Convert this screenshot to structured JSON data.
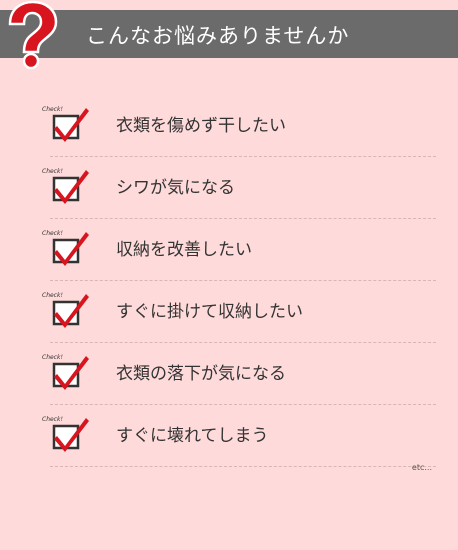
{
  "header": {
    "title": "こんなお悩みありませんか"
  },
  "check_tag": "Check!",
  "items": [
    {
      "label": "衣類を傷めず干したい"
    },
    {
      "label": "シワが気になる"
    },
    {
      "label": "収納を改善したい"
    },
    {
      "label": "すぐに掛けて収納したい"
    },
    {
      "label": "衣類の落下が気になる"
    },
    {
      "label": "すぐに壊れてしまう"
    }
  ],
  "footer": {
    "etc": "etc..."
  },
  "colors": {
    "background": "#fedada",
    "header": "#6b6b6b",
    "accent_red": "#d8141f"
  },
  "icons": {
    "header_icon": "question-mark-icon",
    "item_icon": "checkbox-checked-icon"
  }
}
